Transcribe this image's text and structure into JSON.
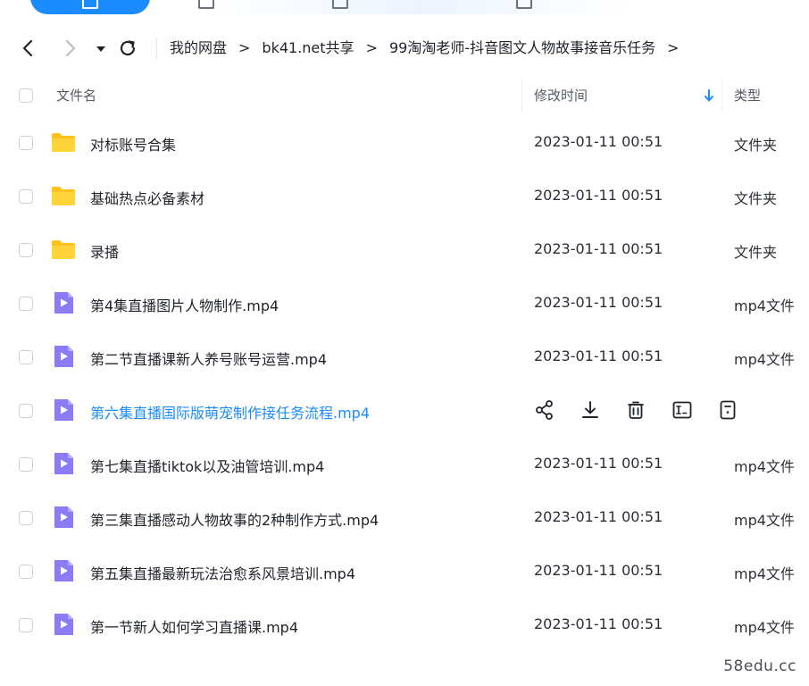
{
  "breadcrumb": {
    "items": [
      "我的网盘",
      "bk41.net共享",
      "99淘淘老师-抖音图文人物故事接音乐任务"
    ],
    "separator": ">"
  },
  "header": {
    "name": "文件名",
    "modified": "修改时间",
    "type": "类型"
  },
  "rows": [
    {
      "name": "对标账号合集",
      "time": "2023-01-11 00:51",
      "type": "文件夹",
      "kind": "folder"
    },
    {
      "name": "基础热点必备素材",
      "time": "2023-01-11 00:51",
      "type": "文件夹",
      "kind": "folder"
    },
    {
      "name": "录播",
      "time": "2023-01-11 00:51",
      "type": "文件夹",
      "kind": "folder"
    },
    {
      "name": "第4集直播图片人物制作.mp4",
      "time": "2023-01-11 00:51",
      "type": "mp4文件",
      "kind": "video"
    },
    {
      "name": "第二节直播课新人养号账号运营.mp4",
      "time": "2023-01-11 00:51",
      "type": "mp4文件",
      "kind": "video"
    },
    {
      "name": "第六集直播国际版萌宠制作接任务流程.mp4",
      "time": "",
      "type": "",
      "kind": "video",
      "hover": true
    },
    {
      "name": "第七集直播tiktok以及油管培训.mp4",
      "time": "2023-01-11 00:51",
      "type": "mp4文件",
      "kind": "video"
    },
    {
      "name": "第三集直播感动人物故事的2种制作方式.mp4",
      "time": "2023-01-11 00:51",
      "type": "mp4文件",
      "kind": "video"
    },
    {
      "name": "第五集直播最新玩法治愈系风景培训.mp4",
      "time": "2023-01-11 00:51",
      "type": "mp4文件",
      "kind": "video"
    },
    {
      "name": "第一节新人如何学习直播课.mp4",
      "time": "2023-01-11 00:51",
      "type": "mp4文件",
      "kind": "video"
    }
  ],
  "hover_actions": [
    "share-icon",
    "download-icon",
    "delete-icon",
    "rename-icon",
    "more-icon"
  ],
  "colors": {
    "accent": "#1a8cff",
    "folder": "#ffd43b",
    "video": "#8b7cf6"
  },
  "watermark": "58edu.cc"
}
